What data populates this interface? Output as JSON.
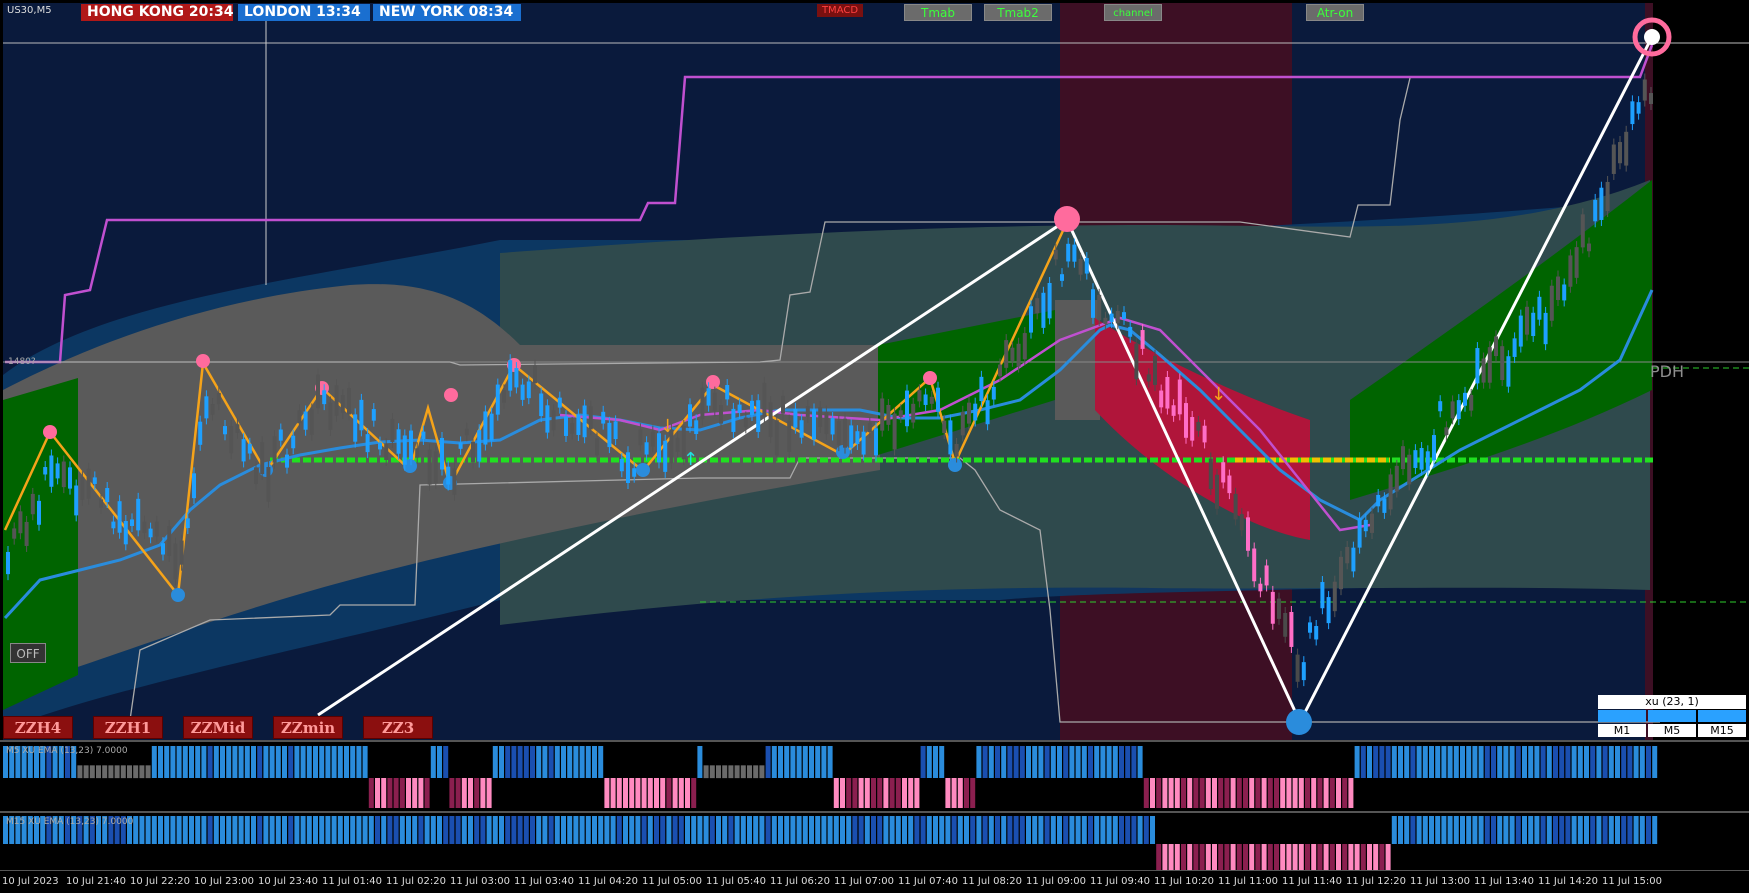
{
  "symbol": "US30,M5",
  "sessions": [
    {
      "city": "HONG KONG",
      "time": "20:34",
      "color": "#b01818"
    },
    {
      "city": "LONDON",
      "time": "13:34",
      "color": "#1a6fd0"
    },
    {
      "city": "NEW YORK",
      "time": "08:34",
      "color": "#1a6fd0"
    }
  ],
  "toolbar": {
    "tmacd": "TMACD",
    "tmab": "Tmab",
    "tmab2": "Tmab2",
    "channel": "channel",
    "atr_on": "Atr-on"
  },
  "zigzag_buttons": [
    "ZZH4",
    "ZZH1",
    "ZZMid",
    "ZZmin",
    "ZZ3"
  ],
  "off_button": "OFF",
  "level_label": "PDH",
  "price_label": "1480?",
  "xu_panel": {
    "title": "xu (23, 1)",
    "timeframes": [
      "M1",
      "M5",
      "M15"
    ]
  },
  "subwindows": [
    {
      "label": "M5 XU EMA (13,23) 7.0000"
    },
    {
      "label": "M15 XU EMA (13,23) 7.0000"
    }
  ],
  "time_axis": [
    "10 Jul 2023",
    "10 Jul 21:40",
    "10 Jul 22:20",
    "10 Jul 23:00",
    "10 Jul 23:40",
    "11 Jul 01:40",
    "11 Jul 02:20",
    "11 Jul 03:00",
    "11 Jul 03:40",
    "11 Jul 04:20",
    "11 Jul 05:00",
    "11 Jul 05:40",
    "11 Jul 06:20",
    "11 Jul 07:00",
    "11 Jul 07:40",
    "11 Jul 08:20",
    "11 Jul 09:00",
    "11 Jul 09:40",
    "11 Jul 10:20",
    "11 Jul 11:00",
    "11 Jul 11:40",
    "11 Jul 12:20",
    "11 Jul 13:00",
    "11 Jul 13:40",
    "11 Jul 14:20",
    "11 Jul 15:00"
  ],
  "colors": {
    "background": "#0a1a3c",
    "channel_gray": "#5a5a5a",
    "channel_green": "#006400",
    "channel_red": "#b0153a",
    "zigzag": "#f5a31a",
    "ema": "#2a8cdc",
    "bull_candle": "#1ea0ff",
    "bear_candle": "#ff6ec7",
    "support_line": "#20e020",
    "magenta_line": "#c050d0"
  }
}
